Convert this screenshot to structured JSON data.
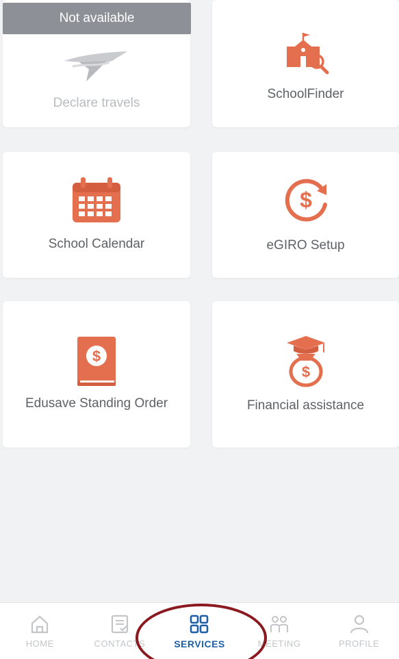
{
  "services": {
    "items": [
      {
        "label": "Declare travels",
        "icon": "plane-hand-icon",
        "status": "Not available"
      },
      {
        "label": "SchoolFinder",
        "icon": "school-search-icon"
      },
      {
        "label": "School Calendar",
        "icon": "calendar-icon"
      },
      {
        "label": "eGIRO Setup",
        "icon": "dollar-refresh-icon"
      },
      {
        "label": "Edusave Standing Order",
        "icon": "dollar-book-icon"
      },
      {
        "label": "Financial assistance",
        "icon": "graduation-moneybag-icon"
      }
    ]
  },
  "tabbar": {
    "tabs": [
      {
        "label": "HOME",
        "icon": "home-icon"
      },
      {
        "label": "CONTACTS",
        "icon": "contacts-icon"
      },
      {
        "label": "SERVICES",
        "icon": "grid-icon",
        "active": true
      },
      {
        "label": "MEETING",
        "icon": "meeting-icon"
      },
      {
        "label": "PROFILE",
        "icon": "profile-icon"
      }
    ]
  },
  "colors": {
    "accent": "#e46f4f",
    "active_tab": "#1e5fa6",
    "badge_bg": "#8d9096",
    "annotation": "#8a1a1f"
  }
}
